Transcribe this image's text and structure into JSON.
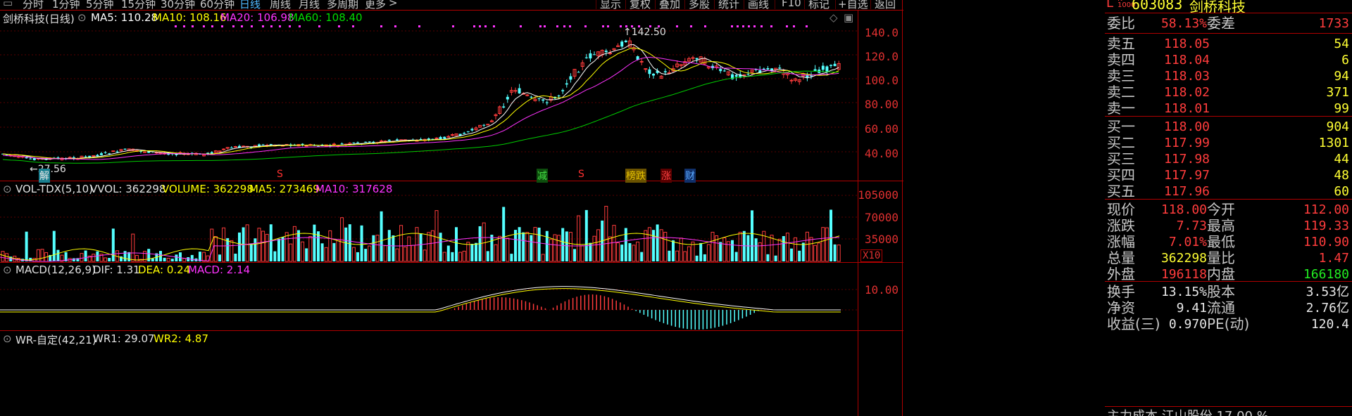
{
  "toolbar": {
    "periods": [
      "分时",
      "1分钟",
      "5分钟",
      "15分钟",
      "30分钟",
      "60分钟",
      "日线",
      "周线",
      "月线",
      "多周期",
      "更多"
    ],
    "active_period": "日线",
    "actions": [
      "显示",
      "复权",
      "叠加",
      "多股",
      "统计",
      "画线",
      "F10",
      "标记",
      "+自选",
      "返回"
    ]
  },
  "stock": {
    "code": "603083",
    "name": "剑桥科技",
    "chart_title": "剑桥科技(日线)"
  },
  "indicators": {
    "ma": {
      "ma5": "MA5: 110.28",
      "ma10": "MA10: 108.16",
      "ma20": "MA20: 106.98",
      "ma60": "MA60: 108.40"
    },
    "vol": {
      "name": "VOL-TDX(5,10)",
      "vvol": "VVOL: 362298",
      "volume": "VOLUME: 362298",
      "ma5": "MA5: 273469",
      "ma10": "MA10: 317628"
    },
    "macd": {
      "name": "MACD(12,26,9)",
      "dif": "DIF: 1.31",
      "dea": "DEA: 0.24",
      "macd": "MACD: 2.14"
    },
    "wr": {
      "name": "WR-自定(42,21)",
      "wr1": "WR1: 29.07",
      "wr2": "WR2: 4.87"
    }
  },
  "price_axis": [
    "140.0",
    "120.0",
    "100.0",
    "80.00",
    "60.00",
    "40.00"
  ],
  "vol_axis": [
    "105000",
    "70000",
    "35000"
  ],
  "vol_unit": "X10",
  "macd_axis": [
    "10.00"
  ],
  "annotations": {
    "high": "142.50",
    "low": "27.56"
  },
  "event_markers": [
    {
      "label": "解",
      "color": "#20b8c8"
    },
    {
      "label": "S",
      "color": "#ff3030"
    },
    {
      "label": "减",
      "color": "#33cc33"
    },
    {
      "label": "S",
      "color": "#ff3030"
    },
    {
      "label": "榜跌",
      "color": "#e6b800"
    },
    {
      "label": "涨",
      "color": "#ff3030"
    },
    {
      "label": "财",
      "color": "#3399ff"
    }
  ],
  "quote": {
    "weibi": {
      "label": "委比",
      "value": "58.13%",
      "label2": "委差",
      "value2": "1733"
    },
    "asks": [
      {
        "label": "卖五",
        "price": "118.05",
        "vol": "54"
      },
      {
        "label": "卖四",
        "price": "118.04",
        "vol": "6"
      },
      {
        "label": "卖三",
        "price": "118.03",
        "vol": "94"
      },
      {
        "label": "卖二",
        "price": "118.02",
        "vol": "371"
      },
      {
        "label": "卖一",
        "price": "118.01",
        "vol": "99"
      }
    ],
    "bids": [
      {
        "label": "买一",
        "price": "118.00",
        "vol": "904"
      },
      {
        "label": "买二",
        "price": "117.99",
        "vol": "1301"
      },
      {
        "label": "买三",
        "price": "117.98",
        "vol": "44"
      },
      {
        "label": "买四",
        "price": "117.97",
        "vol": "48"
      },
      {
        "label": "买五",
        "price": "117.96",
        "vol": "60"
      }
    ],
    "stats": [
      {
        "l1": "现价",
        "v1": "118.00",
        "c1": "r",
        "l2": "今开",
        "v2": "112.00",
        "c2": "r"
      },
      {
        "l1": "涨跌",
        "v1": "7.73",
        "c1": "r",
        "l2": "最高",
        "v2": "119.33",
        "c2": "r"
      },
      {
        "l1": "涨幅",
        "v1": "7.01%",
        "c1": "r",
        "l2": "最低",
        "v2": "110.90",
        "c2": "r"
      },
      {
        "l1": "总量",
        "v1": "362298",
        "c1": "y",
        "l2": "量比",
        "v2": "1.47",
        "c2": "r"
      },
      {
        "l1": "外盘",
        "v1": "196118",
        "c1": "r",
        "l2": "内盘",
        "v2": "166180",
        "c2": "g"
      },
      {
        "l1": "换手",
        "v1": "13.15%",
        "c1": "w",
        "l2": "股本",
        "v2": "3.53亿",
        "c2": "w"
      },
      {
        "l1": "净资",
        "v1": "9.41",
        "c1": "w",
        "l2": "流通",
        "v2": "2.76亿",
        "c2": "w"
      },
      {
        "l1": "收益(三)",
        "v1": "0.970",
        "c1": "w",
        "l2": "PE(动)",
        "v2": "120.4",
        "c2": "w"
      }
    ],
    "footer": "主力成本 江山股份 17.00 %"
  },
  "colors": {
    "up": "#ff3c3c",
    "down": "#54ffff",
    "ma5": "#ffffff",
    "ma10": "#ffff00",
    "ma20": "#ff33ff",
    "ma60": "#00cc00",
    "frame": "#b00000"
  }
}
